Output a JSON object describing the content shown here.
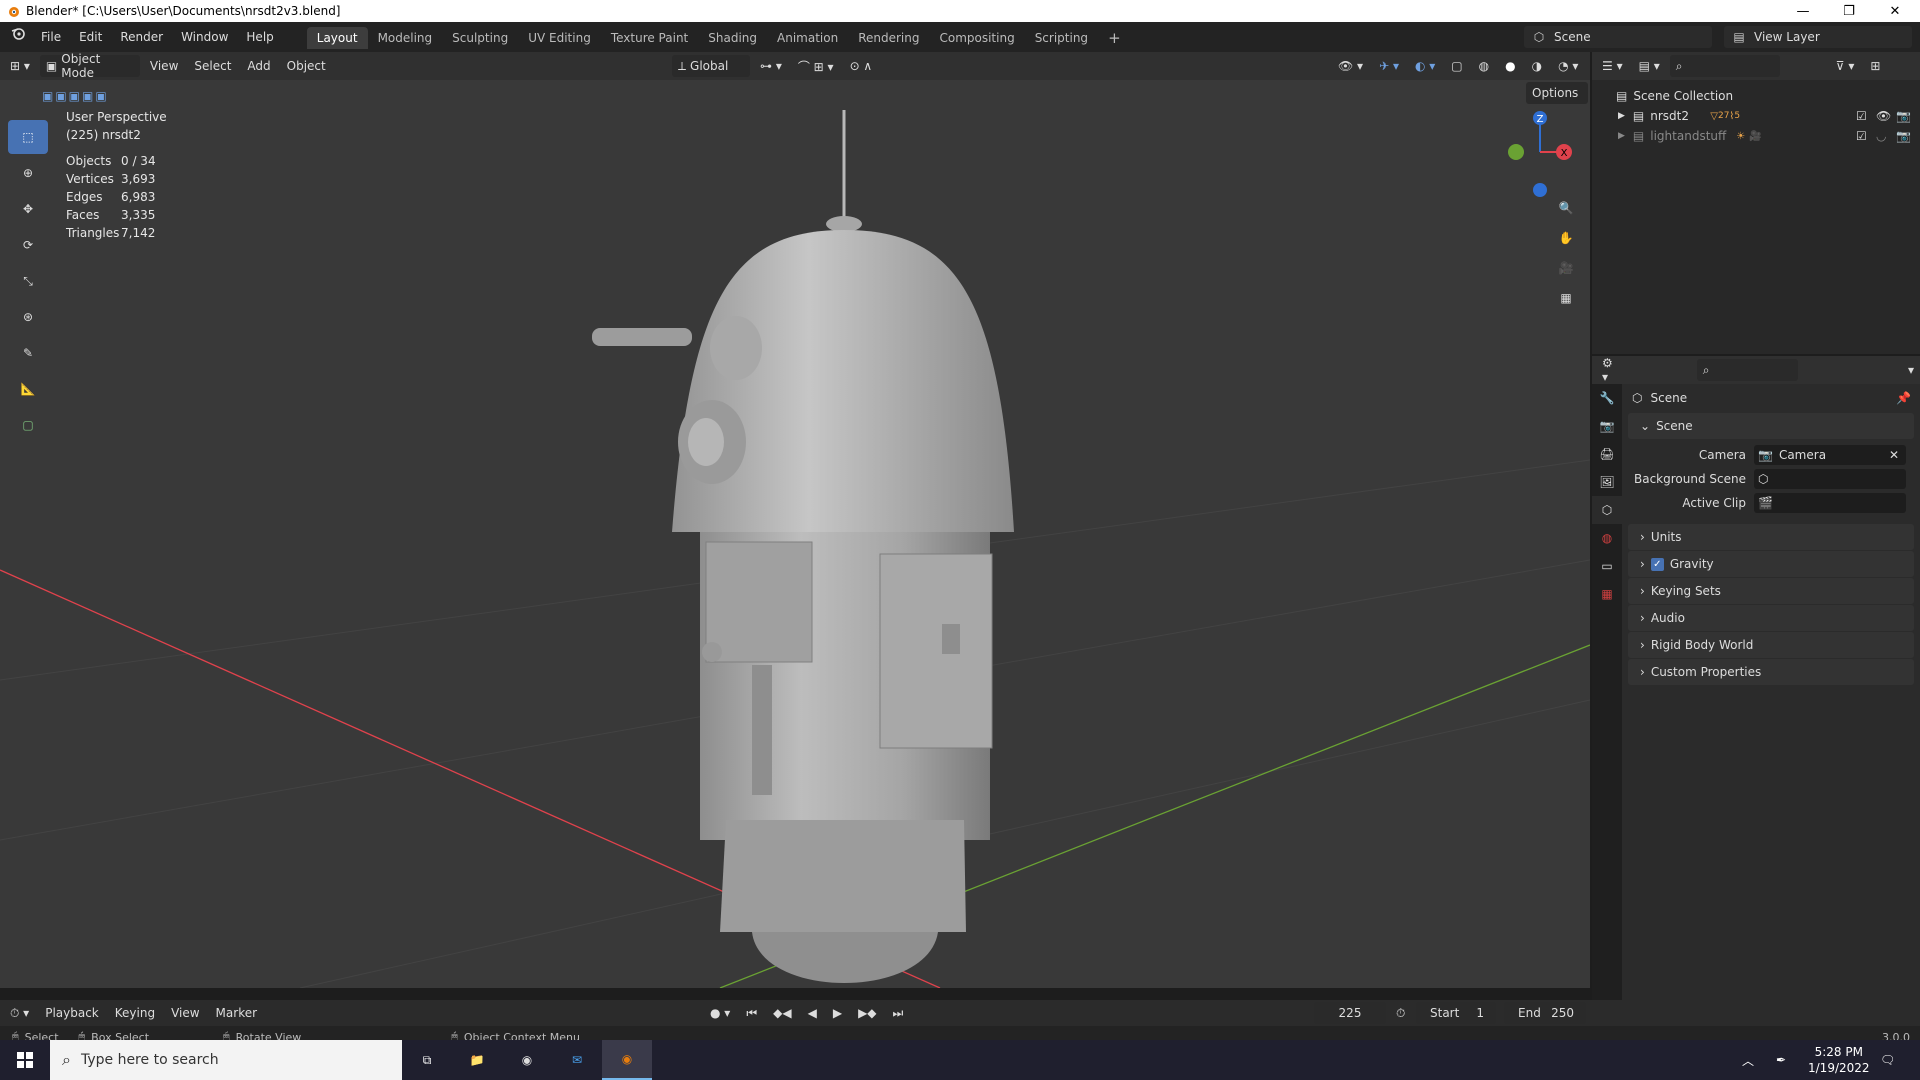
{
  "window": {
    "title": "Blender* [C:\\Users\\User\\Documents\\nrsdt2v3.blend]"
  },
  "menu": {
    "items": [
      "File",
      "Edit",
      "Render",
      "Window",
      "Help"
    ]
  },
  "workspaces": {
    "tabs": [
      "Layout",
      "Modeling",
      "Sculpting",
      "UV Editing",
      "Texture Paint",
      "Shading",
      "Animation",
      "Rendering",
      "Compositing",
      "Scripting"
    ],
    "active": "Layout",
    "add": "+"
  },
  "scene_selector": {
    "scene": "Scene",
    "view_layer": "View Layer"
  },
  "viewport_header": {
    "mode": "Object Mode",
    "menus": [
      "View",
      "Select",
      "Add",
      "Object"
    ],
    "transform": "Global",
    "options": "Options"
  },
  "viewport": {
    "perspective": "User Perspective",
    "object": "(225) nrsdt2",
    "stats": [
      {
        "k": "Objects",
        "v": "0 / 34"
      },
      {
        "k": "Vertices",
        "v": "3,693"
      },
      {
        "k": "Edges",
        "v": "6,983"
      },
      {
        "k": "Faces",
        "v": "3,335"
      },
      {
        "k": "Triangles",
        "v": "7,142"
      }
    ],
    "axis_labels": {
      "x": "X",
      "z": "Z"
    },
    "colors": {
      "x_axis": "#e0424c",
      "y_axis": "#6aa233",
      "z_axis": "#2f6fd4",
      "active_tool": "#4772b3"
    }
  },
  "outliner": {
    "root": "Scene Collection",
    "items": [
      {
        "name": "nrsdt2",
        "badge": "27",
        "badge2": "5"
      },
      {
        "name": "lightandstuff",
        "badge": "",
        "badge2": ""
      }
    ]
  },
  "properties": {
    "header": "Scene",
    "section": "Scene",
    "fields": [
      {
        "label": "Camera",
        "value": "Camera"
      },
      {
        "label": "Background Scene",
        "value": ""
      },
      {
        "label": "Active Clip",
        "value": ""
      }
    ],
    "panels": [
      "Units",
      "Gravity",
      "Keying Sets",
      "Audio",
      "Rigid Body World",
      "Custom Properties"
    ]
  },
  "timeline": {
    "menus": [
      "Playback",
      "Keying",
      "View",
      "Marker"
    ],
    "frame": "225",
    "start_label": "Start",
    "start": "1",
    "end_label": "End",
    "end": "250"
  },
  "statusbar": {
    "items": [
      "Select",
      "Box Select",
      "Rotate View",
      "Object Context Menu"
    ],
    "version": "3.0.0"
  },
  "taskbar": {
    "search_placeholder": "Type here to search",
    "time": "5:28 PM",
    "date": "1/19/2022"
  }
}
